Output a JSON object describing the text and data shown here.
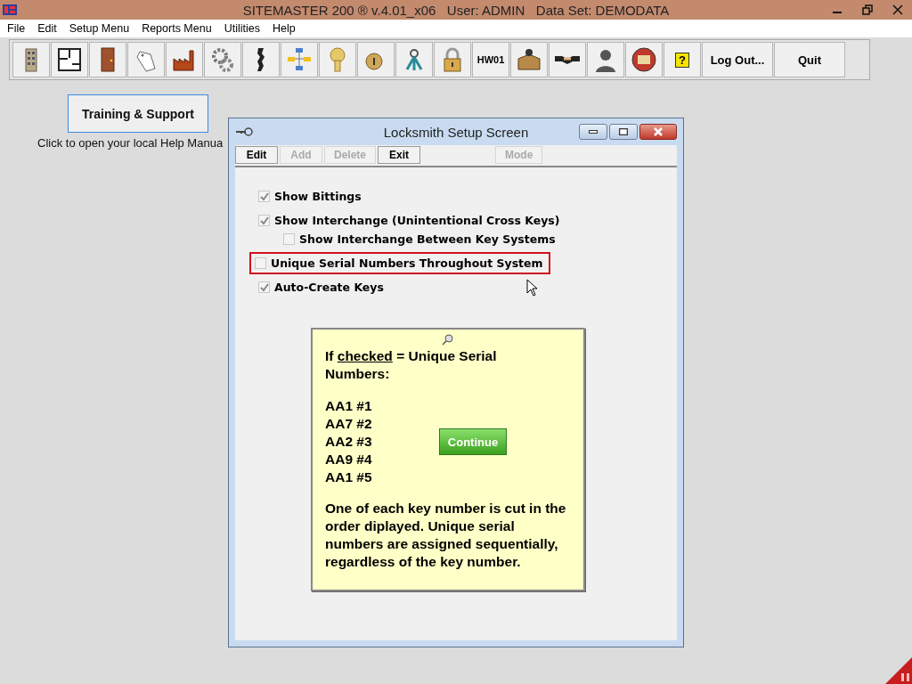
{
  "window": {
    "title": "SITEMASTER 200 ® v.4.01_x06   User: ADMIN   Data Set: DEMODATA"
  },
  "menu": [
    "File",
    "Edit",
    "Setup Menu",
    "Reports Menu",
    "Utilities",
    "Help"
  ],
  "toolbar": [
    {
      "kind": "icon"
    },
    {
      "kind": "icon"
    },
    {
      "kind": "icon"
    },
    {
      "kind": "icon"
    },
    {
      "kind": "icon"
    },
    {
      "kind": "icon"
    },
    {
      "kind": "icon"
    },
    {
      "kind": "icon"
    },
    {
      "kind": "icon"
    },
    {
      "kind": "icon"
    },
    {
      "kind": "icon"
    },
    {
      "kind": "icon"
    },
    {
      "kind": "text",
      "label": "HW01"
    },
    {
      "kind": "icon"
    },
    {
      "kind": "icon"
    },
    {
      "kind": "icon"
    },
    {
      "kind": "icon"
    },
    {
      "kind": "glyph",
      "label": "?"
    },
    {
      "kind": "wide",
      "label": "Log Out..."
    },
    {
      "kind": "wide",
      "label": "Quit"
    }
  ],
  "training_button": "Training & Support",
  "help_text": "Click to open your local Help Manua",
  "dialog": {
    "title": "Locksmith Setup Screen",
    "buttons": [
      {
        "label": "Edit",
        "disabled": false
      },
      {
        "label": "Add",
        "disabled": true
      },
      {
        "label": "Delete",
        "disabled": true
      },
      {
        "label": "Exit",
        "disabled": false
      },
      {
        "label": "Mode",
        "disabled": true
      }
    ],
    "options": [
      {
        "label": "Show Bittings",
        "checked": true,
        "highlighted": false
      },
      {
        "label": "Show Interchange (Unintentional Cross Keys)",
        "checked": true,
        "highlighted": false,
        "children": [
          {
            "label": "Show Interchange Between Key Systems",
            "checked": false,
            "highlighted": false
          }
        ]
      },
      {
        "label": "Unique Serial Numbers Throughout System",
        "checked": false,
        "highlighted": true
      },
      {
        "label": "Auto-Create Keys",
        "checked": true,
        "highlighted": false
      }
    ],
    "tip": {
      "intro": {
        "before": "If ",
        "underlined": "checked",
        "after": " = Unique Serial Numbers:"
      },
      "examples": [
        "AA1 #1",
        "AA7 #2",
        "AA2 #3",
        "AA9 #4",
        "AA1 #5"
      ],
      "button": "Continue",
      "note": "One of each key number is cut in the order diplayed. Unique serial numbers are assigned sequentially, regardless of the key number."
    }
  }
}
